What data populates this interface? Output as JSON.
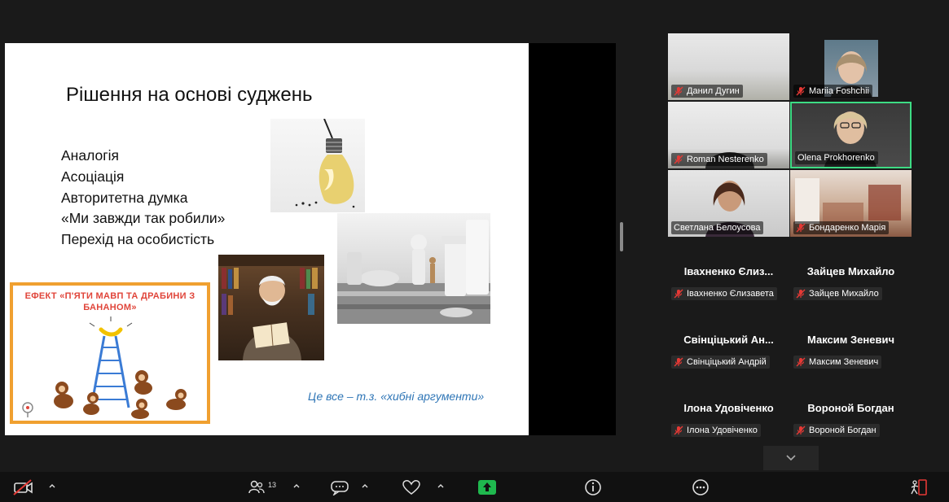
{
  "slide": {
    "title": "Рішення на основі суджень",
    "bullets": [
      "Аналогія",
      "Асоціація",
      "Авторитетна думка",
      "«Ми завжди так робили»",
      "Перехід на особистість"
    ],
    "footnote": "Це все – т.з. «хибні аргументи»",
    "effect_title": "ЕФЕКТ «П'ЯТИ МАВП ТА ДРАБИНИ З БАНАНОМ»"
  },
  "participants": {
    "video_tiles": [
      {
        "name": "Данил Дугин"
      },
      {
        "name": "Mariia Foshchii"
      },
      {
        "name": "Roman Nesterenko"
      },
      {
        "name": "Olena Prokhorenko"
      },
      {
        "name": "Светлана Белоусова"
      },
      {
        "name": "Бондаренко Марія"
      }
    ],
    "name_tiles": [
      {
        "display": "Івахненко Єлиз...",
        "label": "Івахненко Єлизавета"
      },
      {
        "display": "Зайцев Михайло",
        "label": "Зайцев Михайло"
      },
      {
        "display": "Свінціцький Ан...",
        "label": "Свінціцький Андрій"
      },
      {
        "display": "Максим Зеневич",
        "label": "Максим Зеневич"
      },
      {
        "display": "Ілона Удовіченко",
        "label": "Ілона Удовіченко"
      },
      {
        "display": "Вороной Богдан",
        "label": "Вороной Богдан"
      }
    ]
  },
  "toolbar": {
    "participants_count": "13",
    "icons": [
      "video-off-icon",
      "participants-icon",
      "chat-icon",
      "reactions-icon",
      "share-screen-icon",
      "info-icon",
      "more-icon",
      "leave-icon"
    ]
  },
  "colors": {
    "talking_border": "#3ddc84",
    "muted_red": "#e53935",
    "share_green": "#1fb84e",
    "effect_border": "#f0a030",
    "footnote_blue": "#2e75b6"
  }
}
